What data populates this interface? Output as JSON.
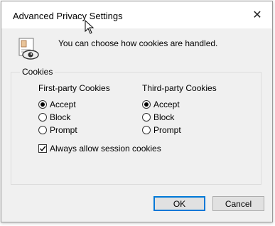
{
  "window": {
    "title": "Advanced Privacy Settings"
  },
  "header": {
    "description": "You can choose how cookies are handled."
  },
  "cookies": {
    "group_label": "Cookies",
    "first_party": {
      "title": "First-party Cookies",
      "options": [
        "Accept",
        "Block",
        "Prompt"
      ],
      "selected": "Accept"
    },
    "third_party": {
      "title": "Third-party Cookies",
      "options": [
        "Accept",
        "Block",
        "Prompt"
      ],
      "selected": "Accept"
    },
    "session": {
      "label": "Always allow session cookies",
      "checked": true
    }
  },
  "buttons": {
    "ok": "OK",
    "cancel": "Cancel"
  },
  "colors": {
    "accent": "#0078d7",
    "dialog_bg": "#f0f0f0"
  }
}
